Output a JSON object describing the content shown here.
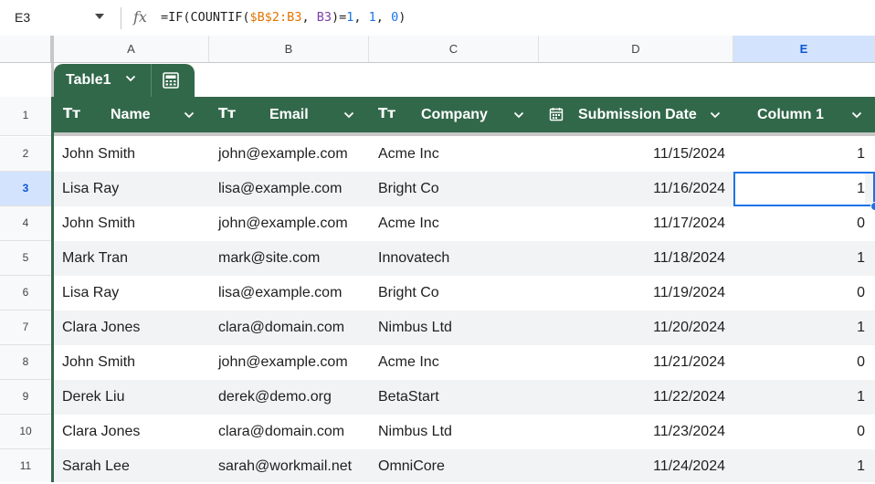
{
  "formula_bar": {
    "cell_ref": "E3",
    "fx_label": "fx",
    "formula_parts": [
      "=IF(COUNTIF(",
      "$B$2:B3",
      ", ",
      "B3",
      ")=",
      "1",
      ", ",
      "1",
      ", ",
      "0",
      ")"
    ]
  },
  "columns": [
    "A",
    "B",
    "C",
    "D",
    "E"
  ],
  "selected_column": "E",
  "table": {
    "name": "Table1",
    "headers": [
      {
        "type_icon": "Tт",
        "label": "Name"
      },
      {
        "type_icon": "Tт",
        "label": "Email"
      },
      {
        "type_icon": "Tт",
        "label": "Company"
      },
      {
        "type_icon": "calendar-icon",
        "label": "Submission Date"
      },
      {
        "type_icon": "",
        "label": "Column 1"
      }
    ]
  },
  "rows": [
    {
      "num": "1"
    },
    {
      "num": "2",
      "name": "John Smith",
      "email": "john@example.com",
      "company": "Acme Inc",
      "date": "11/15/2024",
      "col1": "1"
    },
    {
      "num": "3",
      "name": "Lisa Ray",
      "email": "lisa@example.com",
      "company": "Bright Co",
      "date": "11/16/2024",
      "col1": "1"
    },
    {
      "num": "4",
      "name": "John Smith",
      "email": "john@example.com",
      "company": "Acme Inc",
      "date": "11/17/2024",
      "col1": "0"
    },
    {
      "num": "5",
      "name": "Mark Tran",
      "email": "mark@site.com",
      "company": "Innovatech",
      "date": "11/18/2024",
      "col1": "1"
    },
    {
      "num": "6",
      "name": "Lisa Ray",
      "email": "lisa@example.com",
      "company": "Bright Co",
      "date": "11/19/2024",
      "col1": "0"
    },
    {
      "num": "7",
      "name": "Clara Jones",
      "email": "clara@domain.com",
      "company": "Nimbus Ltd",
      "date": "11/20/2024",
      "col1": "1"
    },
    {
      "num": "8",
      "name": "John Smith",
      "email": "john@example.com",
      "company": "Acme Inc",
      "date": "11/21/2024",
      "col1": "0"
    },
    {
      "num": "9",
      "name": "Derek Liu",
      "email": "derek@demo.org",
      "company": "BetaStart",
      "date": "11/22/2024",
      "col1": "1"
    },
    {
      "num": "10",
      "name": "Clara Jones",
      "email": "clara@domain.com",
      "company": "Nimbus Ltd",
      "date": "11/23/2024",
      "col1": "0"
    },
    {
      "num": "11",
      "name": "Sarah Lee",
      "email": "sarah@workmail.net",
      "company": "OmniCore",
      "date": "11/24/2024",
      "col1": "1"
    }
  ],
  "selected_row": "3",
  "colors": {
    "table_header": "#32684a",
    "selection": "#1a73e8",
    "formula_range_1": "#e37400",
    "formula_range_2": "#7b3ea8"
  }
}
